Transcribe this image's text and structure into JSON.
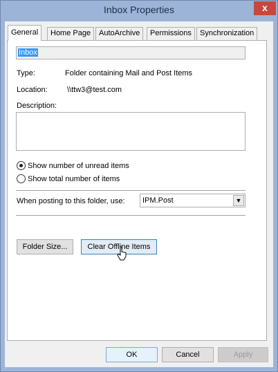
{
  "window": {
    "title": "Inbox Properties",
    "close_glyph": "x"
  },
  "tabs": [
    {
      "label": "General"
    },
    {
      "label": "Home Page"
    },
    {
      "label": "AutoArchive"
    },
    {
      "label": "Permissions"
    },
    {
      "label": "Synchronization"
    }
  ],
  "general": {
    "folder_name": "Inbox",
    "type_label": "Type:",
    "type_value": "Folder containing Mail and Post Items",
    "location_label": "Location:",
    "location_value": "\\\\ttw3@test.com",
    "description_label": "Description:",
    "description_value": "",
    "radio_unread_label": "Show number of unread items",
    "radio_total_label": "Show total number of items",
    "radio_selected": "unread",
    "posting_label": "When posting to this folder, use:",
    "posting_value": "IPM.Post",
    "folder_size_button": "Folder Size...",
    "clear_offline_button": "Clear Offline Items"
  },
  "footer": {
    "ok": "OK",
    "cancel": "Cancel",
    "apply": "Apply"
  },
  "colors": {
    "title_bar": "#9cb4d8",
    "close_button": "#c9463d",
    "selection": "#3399ff"
  }
}
